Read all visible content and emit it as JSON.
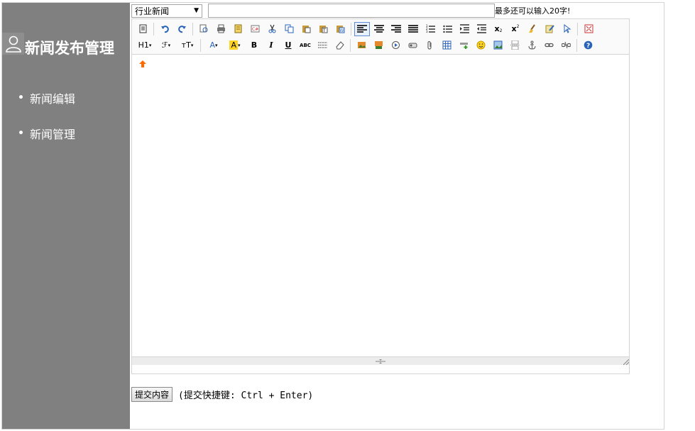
{
  "app": {
    "brand_title": "新闻发布管理",
    "avatar_icon": "user-icon"
  },
  "sidebar": {
    "items": [
      {
        "label": "新闻编辑"
      },
      {
        "label": "新闻管理"
      }
    ]
  },
  "form": {
    "category_selected": "行业新闻",
    "title_value": "",
    "title_placeholder": "",
    "counter_text": "最多还可以输入20字!",
    "submit_label": "提交内容",
    "shortcut_hint": "(提交快捷键: Ctrl + Enter)"
  },
  "toolbar": {
    "row2": {
      "heading_label": "H1",
      "font_label": "ℱ",
      "size_label": "тT",
      "forecolor_label": "A",
      "backcolor_label": "A",
      "bold_label": "B",
      "italic_label": "I",
      "underline_label": "U",
      "strike_label": "ABC"
    },
    "sub_label": "x",
    "sup_label": "x"
  },
  "colors": {
    "sidebar_bg": "#808080",
    "accent_blue": "#2a64b8",
    "highlight_yellow": "#ffd321",
    "arrow_orange": "#ff6a00"
  }
}
